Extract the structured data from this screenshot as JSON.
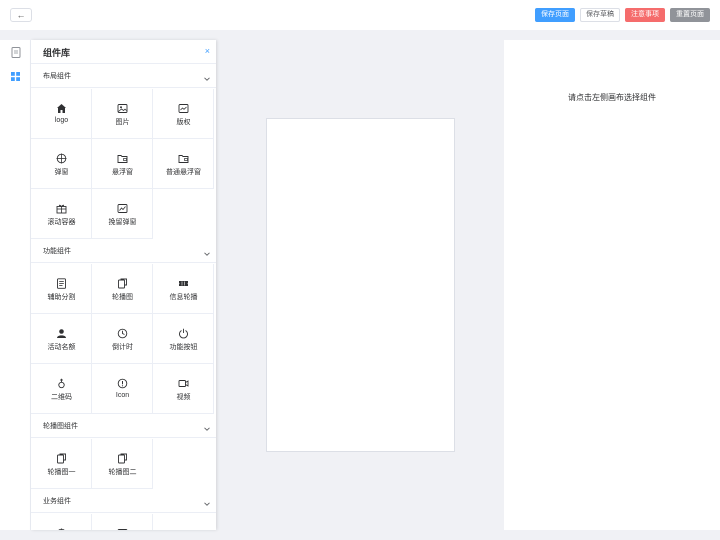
{
  "topbar": {
    "back_label": "←",
    "save_page": "保存页面",
    "save_draft": "保存草稿",
    "notes": "注意事项",
    "reset_page": "重置页面"
  },
  "colors": {
    "primary": "#409eff",
    "danger": "#f56c6c",
    "info": "#909399"
  },
  "sidebar": {
    "tabs": [
      {
        "icon": "page-icon",
        "active": false
      },
      {
        "icon": "components-grid-icon",
        "active": true
      }
    ]
  },
  "panel": {
    "title": "组件库",
    "close_label": "×",
    "sections": [
      {
        "title": "布局组件",
        "items": [
          {
            "label": "logo",
            "icon": "home-icon"
          },
          {
            "label": "图片",
            "icon": "image-icon"
          },
          {
            "label": "版权",
            "icon": "copyright-icon"
          },
          {
            "label": "弹窗",
            "icon": "target-icon"
          },
          {
            "label": "悬浮窗",
            "icon": "wallet-icon"
          },
          {
            "label": "普通悬浮窗",
            "icon": "wallet-icon"
          },
          {
            "label": "滚动容器",
            "icon": "gift-icon"
          },
          {
            "label": "挽留弹窗",
            "icon": "chart-icon"
          }
        ]
      },
      {
        "title": "功能组件",
        "items": [
          {
            "label": "辅助分割",
            "icon": "document-icon"
          },
          {
            "label": "轮播图",
            "icon": "carousel-icon"
          },
          {
            "label": "信息轮播",
            "icon": "ticket-icon"
          },
          {
            "label": "活动名额",
            "icon": "user-icon"
          },
          {
            "label": "倒计时",
            "icon": "clock-icon"
          },
          {
            "label": "功能按钮",
            "icon": "power-icon"
          },
          {
            "label": "二维码",
            "icon": "bulb-icon"
          },
          {
            "label": "Icon",
            "icon": "info-icon"
          },
          {
            "label": "视频",
            "icon": "video-icon"
          }
        ]
      },
      {
        "title": "轮播图组件",
        "items": [
          {
            "label": "轮播图一",
            "icon": "carousel-icon"
          },
          {
            "label": "轮播图二",
            "icon": "carousel-icon"
          }
        ]
      },
      {
        "title": "业务组件",
        "items": [
          {
            "label": "",
            "icon": "target-icon"
          },
          {
            "label": "",
            "icon": "image-icon"
          }
        ]
      }
    ]
  },
  "right_panel": {
    "hint": "请点击左侧画布选择组件"
  }
}
